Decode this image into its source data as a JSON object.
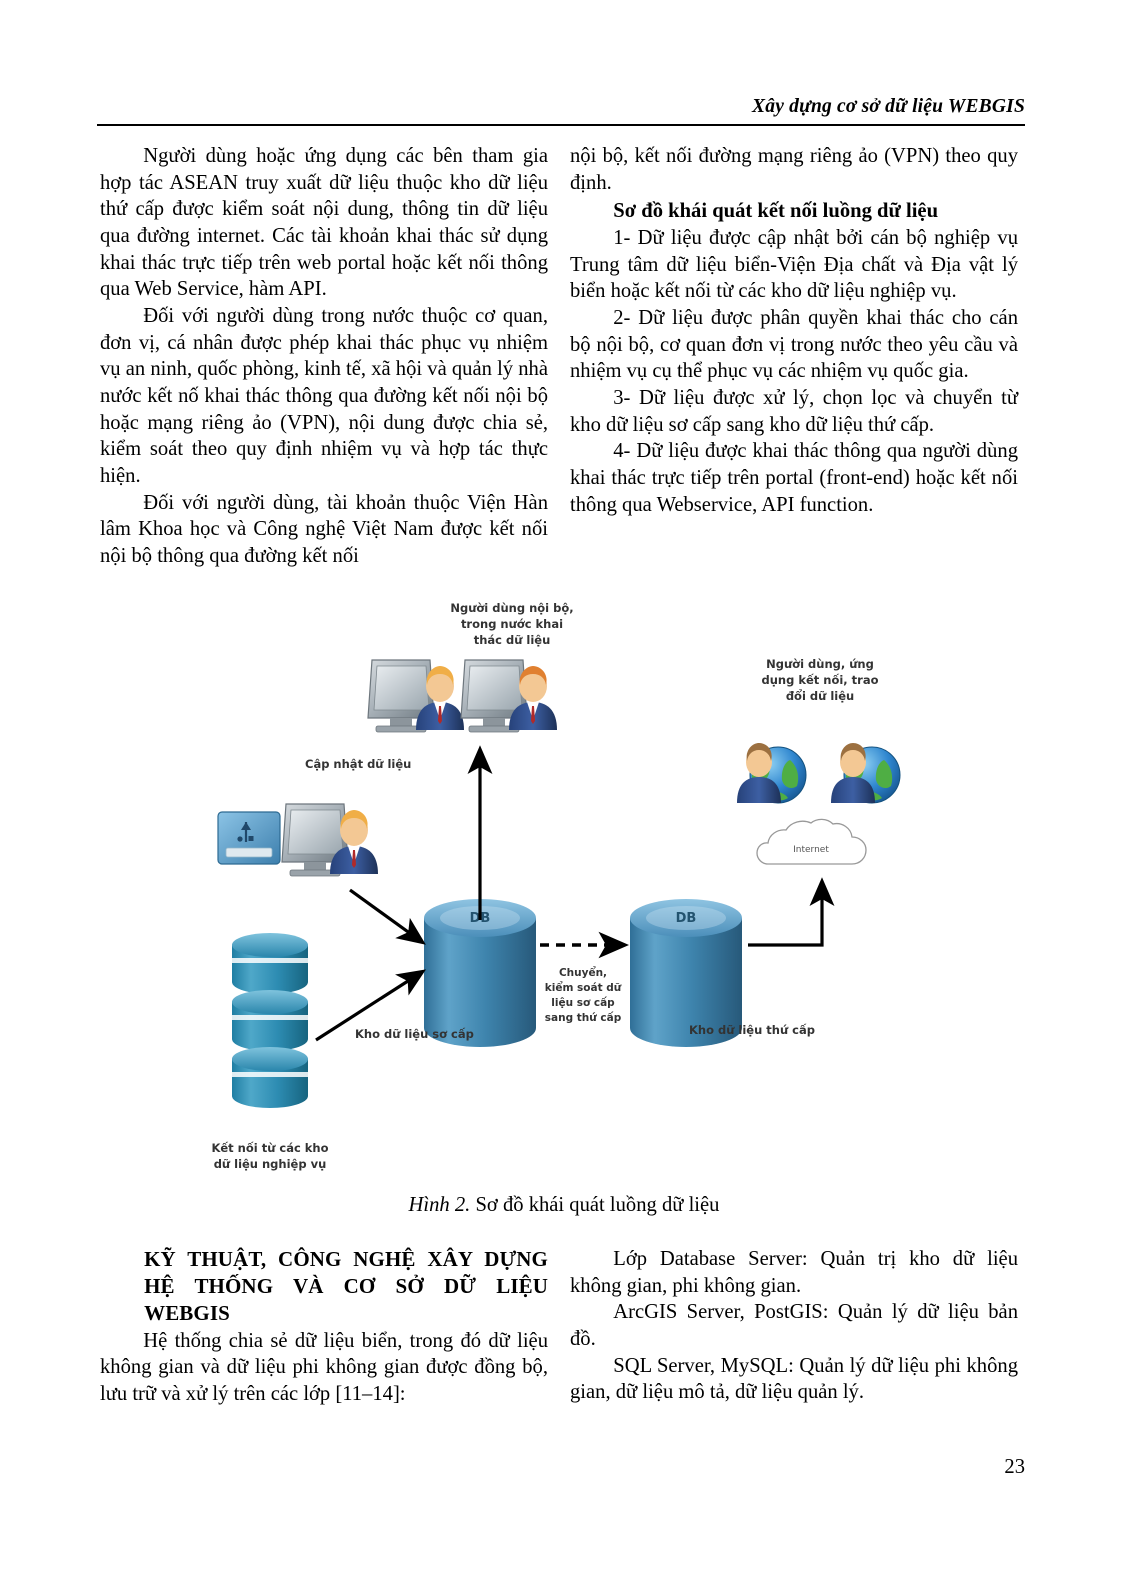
{
  "header": {
    "running_head": "Xây dựng cơ sở dữ liệu WEBGIS"
  },
  "page_number": "23",
  "body": {
    "left_column_top": [
      "Người dùng hoặc ứng dụng các bên tham gia hợp tác ASEAN truy xuất dữ liệu thuộc kho dữ liệu thứ cấp được kiểm soát nội dung, thông tin dữ liệu qua đường internet. Các tài khoản khai thác sử dụng khai thác trực tiếp trên web portal hoặc kết nối thông qua Web Service, hàm API.",
      "Đối với người dùng trong nước thuộc cơ quan, đơn vị, cá nhân được phép khai thác phục vụ nhiệm vụ an ninh, quốc phòng, kinh tế, xã hội và quản lý nhà nước kết nố khai thác thông qua đường kết nối nội bộ hoặc mạng riêng ảo (VPN), nội dung được chia sẻ, kiểm soát theo quy định nhiệm vụ và hợp tác thực hiện.",
      "Đối với người dùng, tài khoản thuộc Viện Hàn lâm Khoa học và Công nghệ Việt Nam được kết nối nội bộ thông qua đường kết nối"
    ],
    "right_column_top_intro": "nội bộ, kết nối đường mạng riêng ảo (VPN) theo quy định.",
    "right_column_subhead": "Sơ đồ khái quát kết nối luồng dữ liệu",
    "right_column_items": [
      "1- Dữ liệu được cập nhật bởi cán bộ nghiệp vụ Trung tâm dữ liệu biển-Viện Địa chất và Địa vật lý biển hoặc kết nối từ các kho dữ liệu nghiệp vụ.",
      "2- Dữ liệu được phân quyền khai thác cho cán bộ nội bộ, cơ quan đơn vị trong nước theo yêu cầu và nhiệm vụ cụ thể phục vụ các nhiệm vụ quốc gia.",
      "3- Dữ liệu được xử lý, chọn lọc và chuyển từ kho dữ liệu sơ cấp sang kho dữ liệu thứ cấp.",
      "4- Dữ liệu được khai thác thông qua người dùng khai thác trực tiếp trên portal (front-end) hoặc kết nối thông qua Webservice, API function."
    ],
    "bottom_section_title_line1": "KỸ THUẬT, CÔNG NGHỆ XÂY DỰNG",
    "bottom_section_title_line2": "HỆ THỐNG VÀ CƠ SỞ DỮ LIỆU",
    "bottom_section_title_line3": "WEBGIS",
    "bottom_left_paragraph": "Hệ thống chia sẻ dữ liệu biển, trong đó dữ liệu không gian và dữ liệu phi không gian được đồng bộ, lưu trữ và xử lý trên các lớp [11–14]:",
    "bottom_right_paragraphs": [
      "Lớp Database Server: Quản trị kho dữ liệu không gian, phi không gian.",
      "ArcGIS Server, PostGIS: Quản lý dữ liệu bản đồ.",
      "SQL Server, MySQL: Quản lý dữ liệu phi không gian, dữ liệu mô tả, dữ liệu quản lý."
    ]
  },
  "figure": {
    "caption_label": "Hình 2.",
    "caption_text": "Sơ đồ khái quát luồng dữ liệu",
    "labels": {
      "internal_users": [
        "Người dùng nội bộ,",
        "trong nước khai",
        "thác dữ liệu"
      ],
      "external_users": [
        "Người dùng, ứng",
        "dụng kết nối, trao",
        "đổi dữ liệu"
      ],
      "update_data": "Cập nhật dữ liệu",
      "primary_store": "Kho dữ liệu sơ cấp",
      "secondary_store": "Kho dữ liệu thứ cấp",
      "transfer": [
        "Chuyển,",
        "kiểm soát dữ",
        "liệu sơ cấp",
        "sang thứ cấp"
      ],
      "business_stores": [
        "Kết nối từ các kho",
        "dữ liệu nghiệp vụ"
      ],
      "internet_cloud": "Internet",
      "db_badge": "DB"
    },
    "colors": {
      "db_cylinder": "#3a7ca8",
      "db_cylinder_light": "#5b9dc6",
      "stack_cylinder": "#2f8fb5",
      "globe_blue": "#2f7fc4",
      "globe_green": "#4fae44",
      "person_shirt": "#2e4f8f",
      "person_skin": "#f0c08a",
      "monitor_gray": "#9aa3ab",
      "arrow": "#000000",
      "cloud_outline": "#888888"
    }
  }
}
